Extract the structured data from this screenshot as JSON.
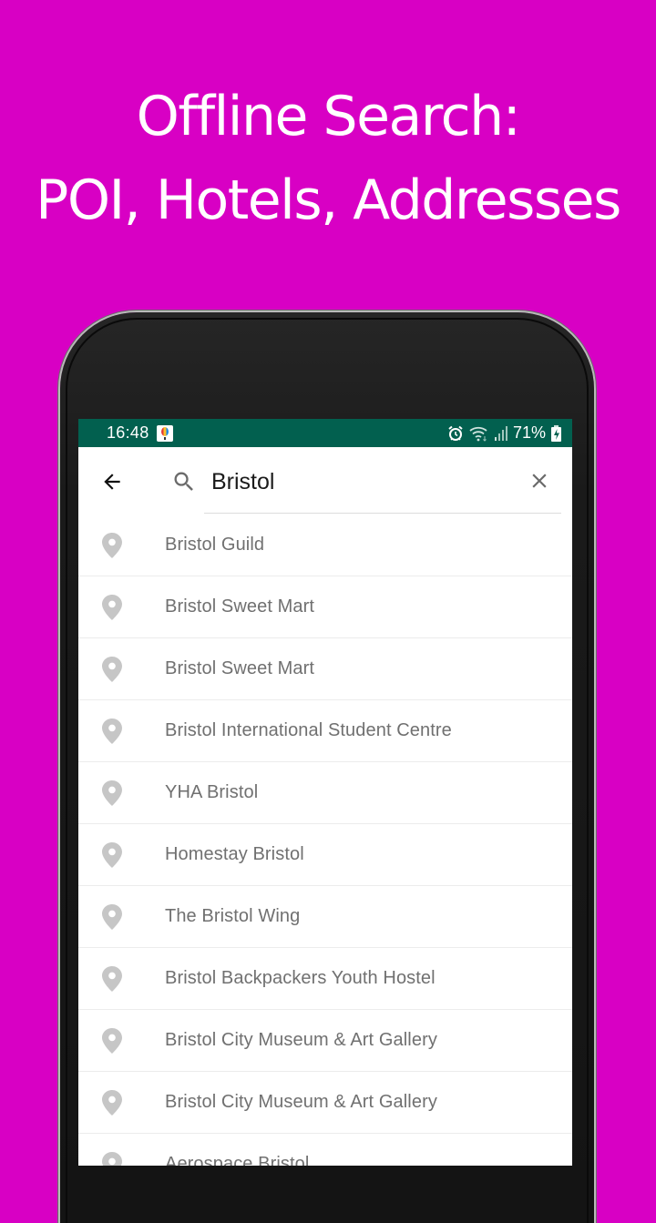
{
  "promo": {
    "headline_line1": "Offline Search:",
    "headline_line2": "POI, Hotels, Addresses",
    "background_color": "#d800c4"
  },
  "statusbar": {
    "time": "16:48",
    "battery_percent": "71%",
    "icons": [
      "app-notification-icon",
      "alarm-icon",
      "wifi-icon",
      "signal-icon",
      "battery-charging-icon"
    ],
    "background_color": "#02604f"
  },
  "search": {
    "back_icon": "arrow-left-icon",
    "search_icon": "search-icon",
    "query": "Bristol",
    "clear_icon": "close-icon"
  },
  "results": [
    {
      "label": "Bristol Guild",
      "icon": "place-pin-icon"
    },
    {
      "label": "Bristol Sweet Mart",
      "icon": "place-pin-icon"
    },
    {
      "label": "Bristol Sweet Mart",
      "icon": "place-pin-icon"
    },
    {
      "label": "Bristol International Student Centre",
      "icon": "place-pin-icon"
    },
    {
      "label": "YHA Bristol",
      "icon": "place-pin-icon"
    },
    {
      "label": "Homestay Bristol",
      "icon": "place-pin-icon"
    },
    {
      "label": "The Bristol Wing",
      "icon": "place-pin-icon"
    },
    {
      "label": "Bristol Backpackers Youth Hostel",
      "icon": "place-pin-icon"
    },
    {
      "label": "Bristol City Museum & Art Gallery",
      "icon": "place-pin-icon"
    },
    {
      "label": "Bristol City Museum & Art Gallery",
      "icon": "place-pin-icon"
    },
    {
      "label": "Aerospace Bristol",
      "icon": "place-pin-icon"
    }
  ]
}
